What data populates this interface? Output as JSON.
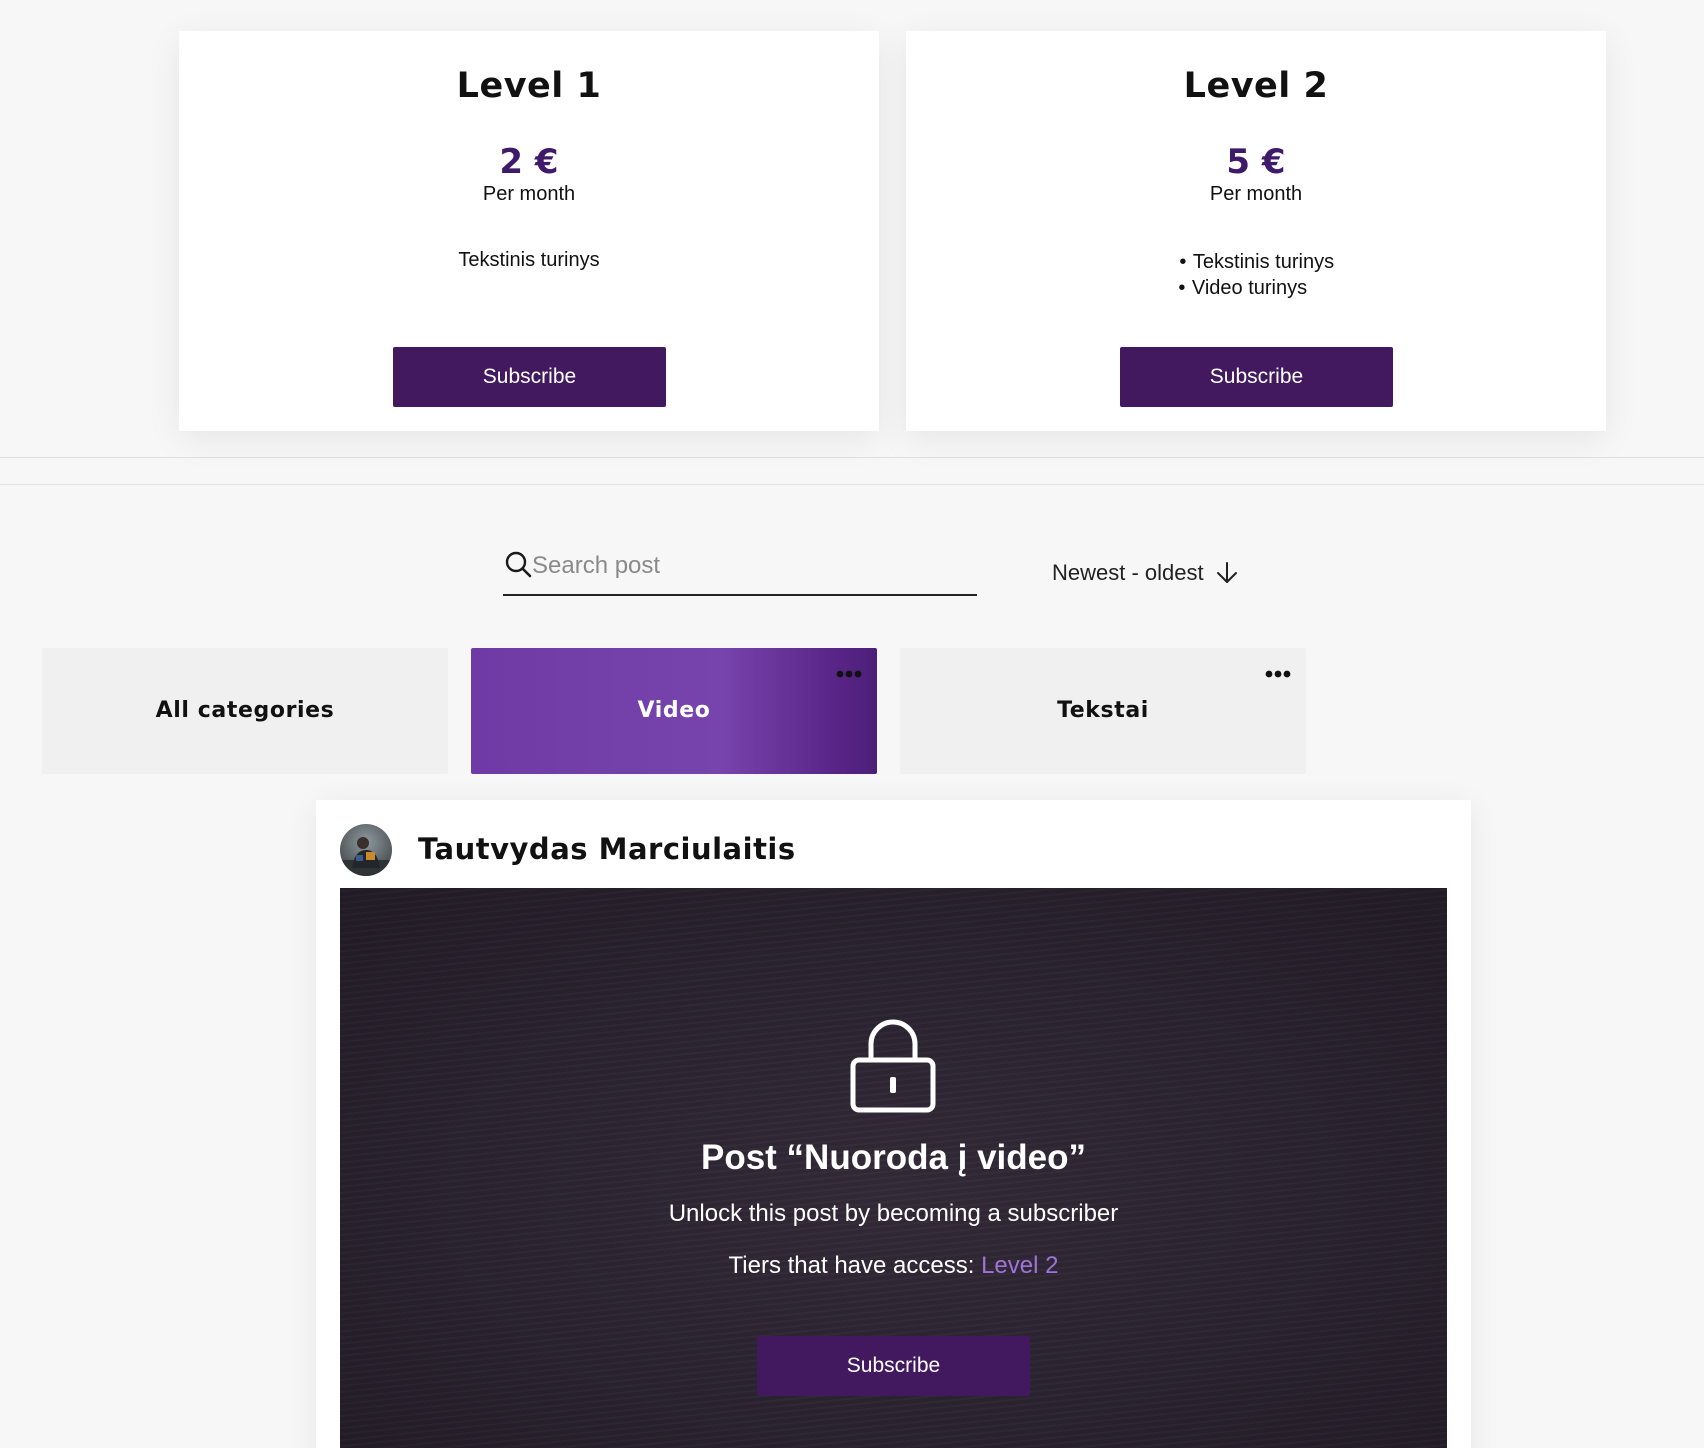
{
  "tiers": [
    {
      "title": "Level 1",
      "price": "2 €",
      "period": "Per month",
      "features": [
        "Tekstinis turinys"
      ],
      "button": "Subscribe"
    },
    {
      "title": "Level 2",
      "price": "5 €",
      "period": "Per month",
      "features": [
        "Tekstinis turinys",
        "Video turinys"
      ],
      "button": "Subscribe"
    }
  ],
  "search": {
    "placeholder": "Search post",
    "value": ""
  },
  "sort": {
    "label": "Newest - oldest",
    "icon": "arrow-down-icon"
  },
  "categories": [
    {
      "label": "All categories",
      "active": false,
      "has_menu": false
    },
    {
      "label": "Video",
      "active": true,
      "has_menu": true
    },
    {
      "label": "Tekstai",
      "active": false,
      "has_menu": true
    }
  ],
  "post": {
    "author": "Tautvydas Marciulaitis",
    "locked": {
      "title": "Post “Nuoroda į video”",
      "subtitle": "Unlock this post by becoming a subscriber",
      "tiers_prefix": "Tiers that have access: ",
      "tiers_link": "Level 2",
      "button": "Subscribe"
    }
  },
  "colors": {
    "brand_dark": "#42195f",
    "price": "#3f1a6b",
    "active_category": "#7744ad",
    "tier_link": "#a173d6",
    "locked_bg": "#2b2430"
  }
}
